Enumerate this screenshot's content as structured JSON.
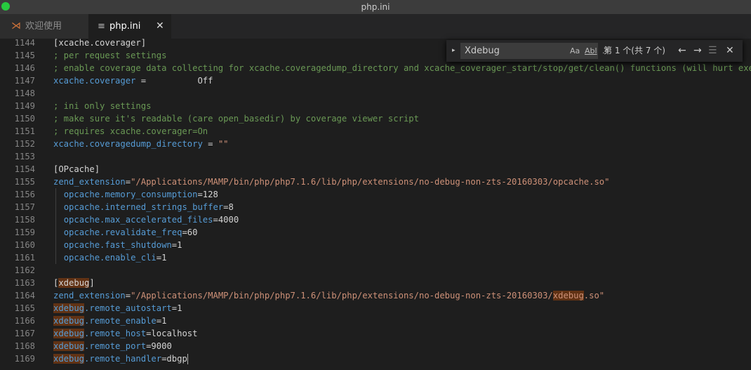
{
  "window": {
    "title": "php.ini"
  },
  "tabs": [
    {
      "icon": "vscode-icon",
      "label": "欢迎使用"
    },
    {
      "icon": "file-lines-icon",
      "label": "php.ini",
      "close": "✕"
    }
  ],
  "find_widget": {
    "toggle": "▸",
    "query": "Xdebug",
    "match_case": "Aa",
    "whole_word": "Abl",
    "regex": ".*",
    "count": "第 1 个(共 7 个)",
    "prev": "←",
    "next": "→",
    "in_selection": "☰",
    "close": "✕"
  },
  "editor": {
    "lines": [
      {
        "num": "1144",
        "segments": [
          {
            "t": "[xcache.coverager]",
            "c": "plain"
          }
        ]
      },
      {
        "num": "1145",
        "segments": [
          {
            "t": "; per request settings",
            "c": "comment"
          }
        ]
      },
      {
        "num": "1146",
        "segments": [
          {
            "t": "; enable coverage data collecting for xcache.coveragedump_directory and xcache_coverager_start/stop/get/clean() functions (will hurt execu",
            "c": "comment"
          }
        ]
      },
      {
        "num": "1147",
        "segments": [
          {
            "t": "xcache.coverager",
            "c": "key"
          },
          {
            "t": " =          Off",
            "c": "plain"
          }
        ]
      },
      {
        "num": "1148",
        "segments": []
      },
      {
        "num": "1149",
        "segments": [
          {
            "t": "; ini only settings",
            "c": "comment"
          }
        ]
      },
      {
        "num": "1150",
        "segments": [
          {
            "t": "; make sure it's readable (care open_basedir) by coverage viewer script",
            "c": "comment"
          }
        ]
      },
      {
        "num": "1151",
        "segments": [
          {
            "t": "; requires xcache.coverager=On",
            "c": "comment"
          }
        ]
      },
      {
        "num": "1152",
        "segments": [
          {
            "t": "xcache.coveragedump_directory",
            "c": "key"
          },
          {
            "t": " = ",
            "c": "plain"
          },
          {
            "t": "\"\"",
            "c": "str"
          }
        ]
      },
      {
        "num": "1153",
        "segments": []
      },
      {
        "num": "1154",
        "segments": [
          {
            "t": "[OPcache]",
            "c": "plain"
          }
        ]
      },
      {
        "num": "1155",
        "segments": [
          {
            "t": "zend_extension",
            "c": "key"
          },
          {
            "t": "=",
            "c": "plain"
          },
          {
            "t": "\"/Applications/MAMP/bin/php/php7.1.6/lib/php/extensions/no-debug-non-zts-20160303/opcache.so\"",
            "c": "str"
          }
        ]
      },
      {
        "num": "1156",
        "segments": [
          {
            "t": "  ",
            "c": "plain"
          },
          {
            "t": "opcache.memory_consumption",
            "c": "key"
          },
          {
            "t": "=128",
            "c": "plain"
          }
        ]
      },
      {
        "num": "1157",
        "segments": [
          {
            "t": "  ",
            "c": "plain"
          },
          {
            "t": "opcache.interned_strings_buffer",
            "c": "key"
          },
          {
            "t": "=8",
            "c": "plain"
          }
        ]
      },
      {
        "num": "1158",
        "segments": [
          {
            "t": "  ",
            "c": "plain"
          },
          {
            "t": "opcache.max_accelerated_files",
            "c": "key"
          },
          {
            "t": "=4000",
            "c": "plain"
          }
        ]
      },
      {
        "num": "1159",
        "segments": [
          {
            "t": "  ",
            "c": "plain"
          },
          {
            "t": "opcache.revalidate_freq",
            "c": "key"
          },
          {
            "t": "=60",
            "c": "plain"
          }
        ]
      },
      {
        "num": "1160",
        "segments": [
          {
            "t": "  ",
            "c": "plain"
          },
          {
            "t": "opcache.fast_shutdown",
            "c": "key"
          },
          {
            "t": "=1",
            "c": "plain"
          }
        ]
      },
      {
        "num": "1161",
        "segments": [
          {
            "t": "  ",
            "c": "plain"
          },
          {
            "t": "opcache.enable_cli",
            "c": "key"
          },
          {
            "t": "=1",
            "c": "plain"
          }
        ]
      },
      {
        "num": "1162",
        "segments": []
      },
      {
        "num": "1163",
        "segments": [
          {
            "t": "[",
            "c": "plain"
          },
          {
            "t": "xdebug",
            "c": "plain",
            "hl": true
          },
          {
            "t": "]",
            "c": "plain"
          }
        ]
      },
      {
        "num": "1164",
        "segments": [
          {
            "t": "zend_extension",
            "c": "key"
          },
          {
            "t": "=",
            "c": "plain"
          },
          {
            "t": "\"/Applications/MAMP/bin/php/php7.1.6/lib/php/extensions/no-debug-non-zts-20160303/",
            "c": "str"
          },
          {
            "t": "xdebug",
            "c": "str",
            "hl": true
          },
          {
            "t": ".so\"",
            "c": "str"
          }
        ]
      },
      {
        "num": "1165",
        "segments": [
          {
            "t": "xdebug",
            "c": "key",
            "hl": true
          },
          {
            "t": ".remote_autostart",
            "c": "key"
          },
          {
            "t": "=1",
            "c": "plain"
          }
        ]
      },
      {
        "num": "1166",
        "segments": [
          {
            "t": "xdebug",
            "c": "key",
            "hl": true
          },
          {
            "t": ".remote_enable",
            "c": "key"
          },
          {
            "t": "=1",
            "c": "plain"
          }
        ]
      },
      {
        "num": "1167",
        "segments": [
          {
            "t": "xdebug",
            "c": "key",
            "hl": true
          },
          {
            "t": ".remote_host",
            "c": "key"
          },
          {
            "t": "=localhost",
            "c": "plain"
          }
        ]
      },
      {
        "num": "1168",
        "segments": [
          {
            "t": "xdebug",
            "c": "key",
            "hl": true
          },
          {
            "t": ".remote_port",
            "c": "key"
          },
          {
            "t": "=9000",
            "c": "plain"
          }
        ]
      },
      {
        "num": "1169",
        "segments": [
          {
            "t": "xdebug",
            "c": "key",
            "hl": true
          },
          {
            "t": ".remote_handler",
            "c": "key"
          },
          {
            "t": "=dbgp",
            "c": "plain"
          }
        ],
        "cursor": true
      }
    ]
  }
}
